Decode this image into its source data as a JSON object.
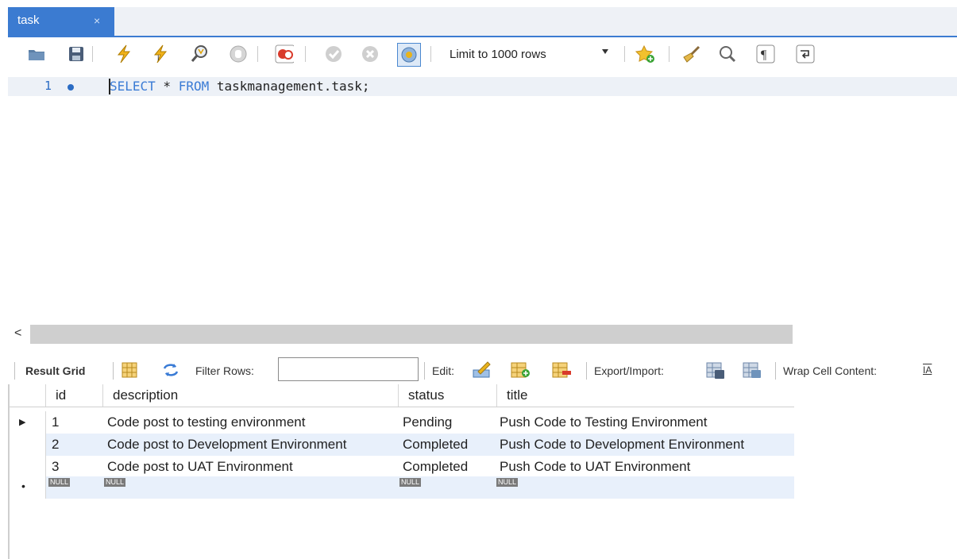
{
  "tab": {
    "title": "task",
    "close_glyph": "×"
  },
  "toolbar": {
    "icons": [
      "folder-open-icon",
      "save-icon",
      "lightning-execute-icon",
      "lightning-cursor-icon",
      "explain-magnifier-icon",
      "stop-icon",
      "toggle-error-icon",
      "commit-icon",
      "rollback-icon",
      "autocommit-icon"
    ],
    "limit_label": "Limit to 1000 rows",
    "right_icons": [
      "snippet-star-icon",
      "beautify-broom-icon",
      "find-icon",
      "invisible-chars-icon",
      "wrap-lines-icon"
    ]
  },
  "editor": {
    "line_number": "1",
    "sql_parts": [
      "SELECT",
      " * ",
      "FROM",
      " taskmanagement.task;"
    ]
  },
  "scroll": {
    "left_glyph": "<"
  },
  "result_toolbar": {
    "result_grid": "Result Grid",
    "filter_label": "Filter Rows:",
    "filter_value": "",
    "edit_label": "Edit:",
    "export_label": "Export/Import:",
    "wrap_label": "Wrap Cell Content:",
    "wrap_glyph": "IA"
  },
  "grid": {
    "columns": [
      "id",
      "description",
      "status",
      "title"
    ],
    "rows": [
      {
        "id": "1",
        "description": "Code post to testing environment",
        "status": "Pending",
        "title": "Push Code to Testing Environment"
      },
      {
        "id": "2",
        "description": "Code post to Development Environment",
        "status": "Completed",
        "title": "Push Code to Development Environment"
      },
      {
        "id": "3",
        "description": "Code post to UAT Environment",
        "status": "Completed",
        "title": "Push Code to UAT Environment"
      }
    ],
    "null_label": "NULL",
    "current_row_marker": "▶",
    "new_row_marker": "•"
  },
  "colors": {
    "accent": "#3b7bd1",
    "keyword": "#3a7bd5",
    "row_alt": "#e8f0fb"
  }
}
